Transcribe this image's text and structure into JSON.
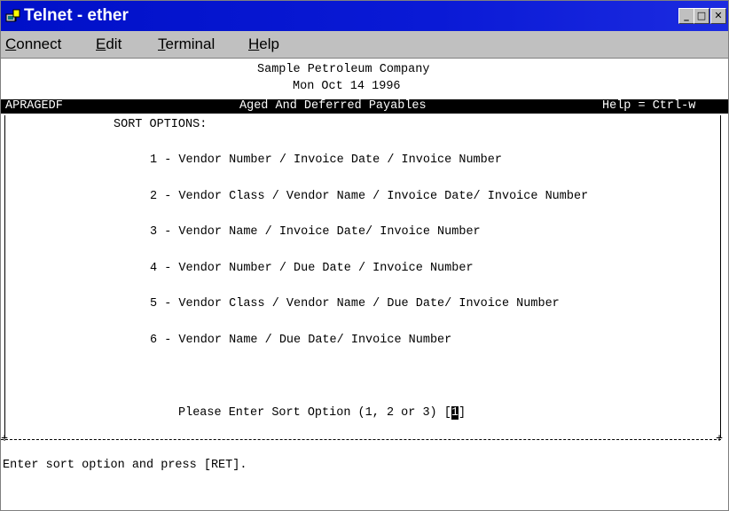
{
  "window": {
    "title": "Telnet - ether",
    "controls": {
      "minimize": "_",
      "maximize": "□",
      "close": "✕"
    }
  },
  "menu": {
    "connect": {
      "mnemonic": "C",
      "rest": "onnect"
    },
    "edit": {
      "mnemonic": "E",
      "rest": "dit"
    },
    "terminal": {
      "mnemonic": "T",
      "rest": "erminal"
    },
    "help": {
      "mnemonic": "H",
      "rest": "elp"
    }
  },
  "terminal": {
    "company": "Sample Petroleum Company",
    "date": "Mon Oct 14 1996",
    "program_id": "APRAGEDF",
    "screen_title": "Aged And Deferred Payables",
    "help_hint": "Help = Ctrl-w",
    "sort_heading": "SORT OPTIONS:",
    "options": [
      "1 - Vendor Number / Invoice Date / Invoice Number",
      "2 - Vendor Class / Vendor Name / Invoice Date/ Invoice Number",
      "3 - Vendor Name / Invoice Date/ Invoice Number",
      "4 - Vendor Number / Due Date / Invoice Number",
      "5 - Vendor Class / Vendor Name / Due Date/ Invoice Number",
      "6 - Vendor Name / Due Date/ Invoice Number"
    ],
    "prompt": "Please Enter Sort Option (1, 2 or 3) [",
    "input_value": "1",
    "prompt_close": "]",
    "status_line": "Enter sort option and press [RET]."
  }
}
